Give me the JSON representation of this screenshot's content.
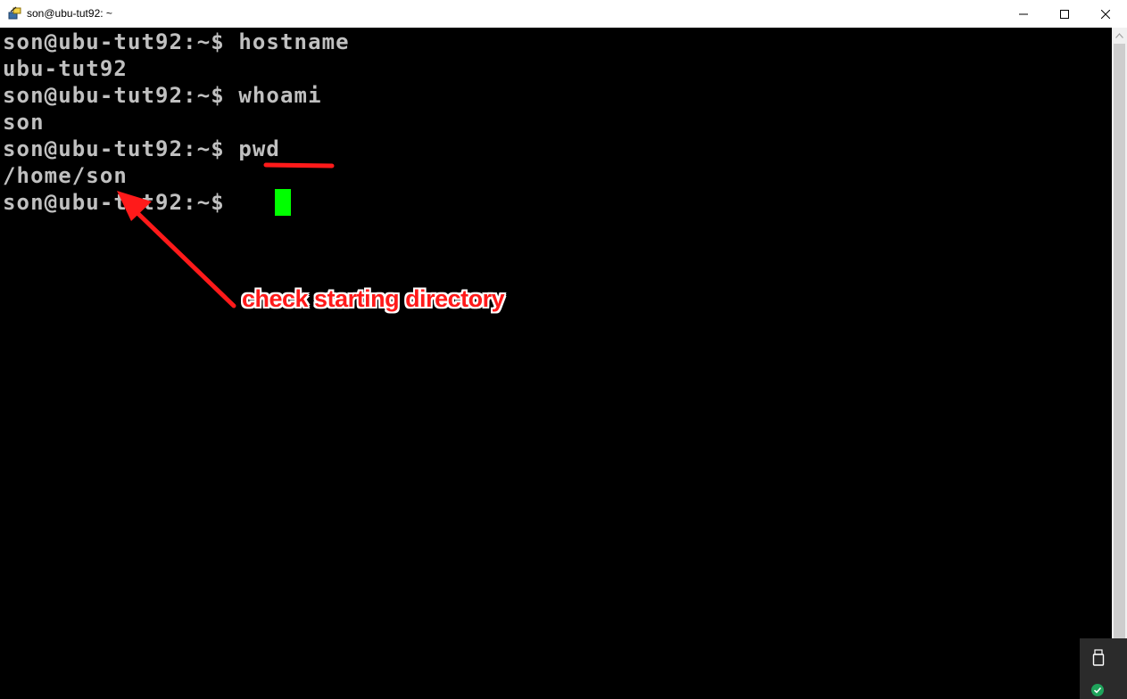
{
  "window": {
    "title": "son@ubu-tut92: ~",
    "icons": {
      "app": "putty-icon",
      "minimize": "minimize-icon",
      "maximize": "maximize-icon",
      "close": "close-icon"
    }
  },
  "terminal": {
    "lines": [
      "son@ubu-tut92:~$ hostname",
      "ubu-tut92",
      "son@ubu-tut92:~$ whoami",
      "son",
      "son@ubu-tut92:~$ pwd",
      "/home/son",
      "son@ubu-tut92:~$ "
    ],
    "colors": {
      "background": "#000000",
      "foreground": "#c0c0c0",
      "cursor": "#00ff00"
    }
  },
  "annotation": {
    "label": "check starting directory",
    "color": "#ff1a1a",
    "underlined_text": "pwd"
  },
  "tray": {
    "icons": [
      "usb-drive-icon",
      "security-shield-icon"
    ]
  }
}
